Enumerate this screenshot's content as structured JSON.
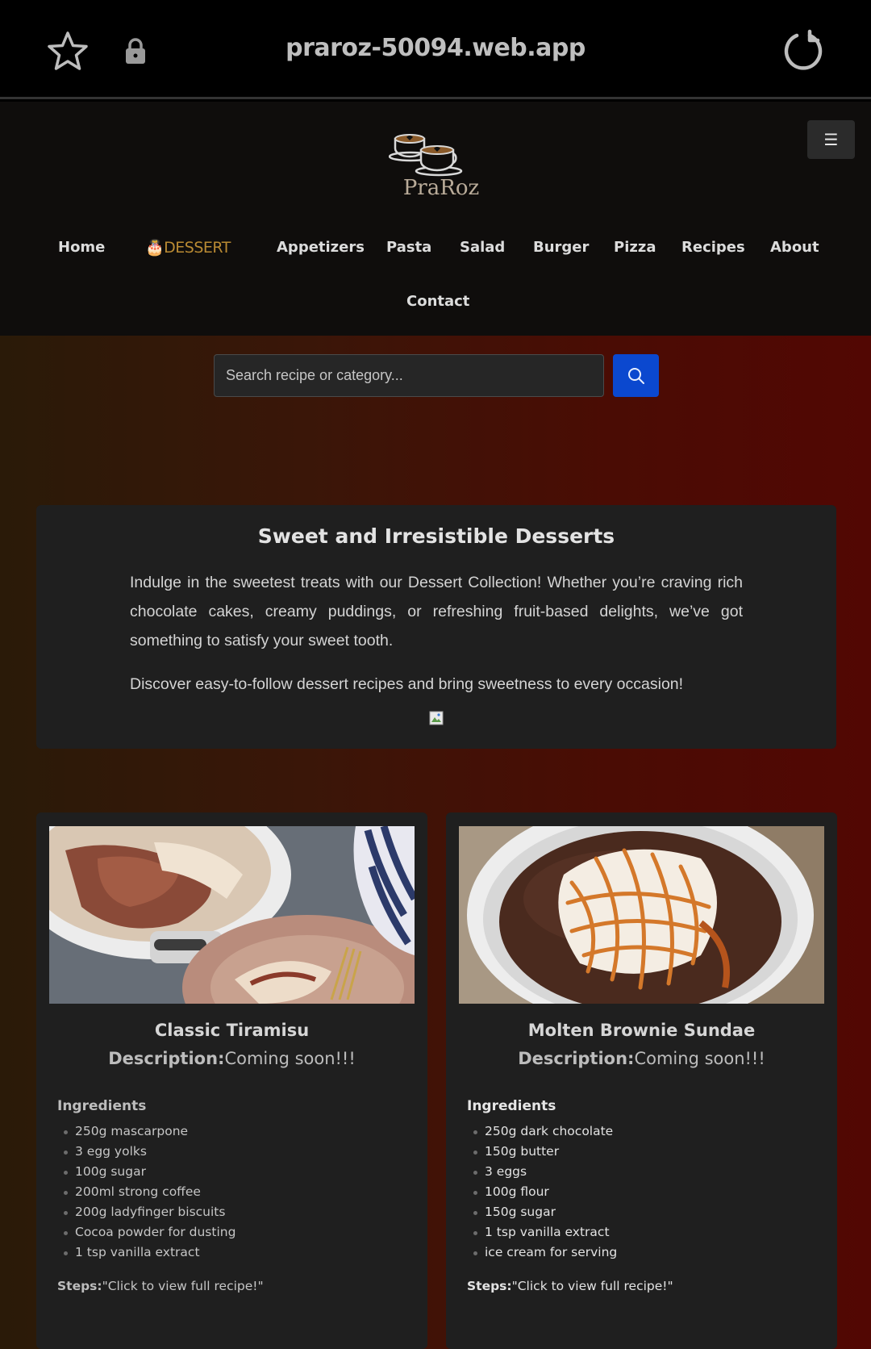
{
  "browser": {
    "url": "praroz-50094.web.app",
    "icons": [
      "star-icon",
      "lock-icon",
      "reload-icon"
    ]
  },
  "header": {
    "logo_text": "PraRoz",
    "menu_icon": "☰",
    "nav": [
      {
        "label": "Home"
      },
      {
        "label": "🎂DESSERT",
        "active": true
      },
      {
        "label": "Appetizers"
      },
      {
        "label": "Pasta"
      },
      {
        "label": "Salad"
      },
      {
        "label": "Burger"
      },
      {
        "label": "Pizza"
      },
      {
        "label": "Recipes"
      },
      {
        "label": "About"
      },
      {
        "label": "Contact"
      }
    ]
  },
  "search": {
    "placeholder": "Search recipe or category...",
    "button_color": "#0b48cf"
  },
  "intro": {
    "title": "Sweet and Irresistible Desserts",
    "paragraph1": "Indulge in the sweetest treats with our Dessert Collection! Whether you’re craving rich chocolate cakes, creamy puddings, or refreshing fruit-based delights, we’ve got something to satisfy your sweet tooth.",
    "paragraph2": "Discover easy-to-follow dessert recipes and bring sweetness to every occasion!"
  },
  "recipes": [
    {
      "title": "Classic Tiramisu",
      "description_label": "Description:",
      "description": "Coming soon!!!",
      "ingredients_heading": "Ingredients",
      "ingredients": [
        "250g mascarpone",
        "3 egg yolks",
        "100g sugar",
        "200ml strong coffee",
        "200g ladyfinger biscuits",
        "Cocoa powder for dusting",
        "1 tsp vanilla extract"
      ],
      "steps_label": "Steps:",
      "steps": "\"Click to view full recipe!\""
    },
    {
      "title": "Molten Brownie Sundae",
      "description_label": "Description:",
      "description": "Coming soon!!!",
      "ingredients_heading": "Ingredients",
      "ingredients": [
        "250g dark chocolate",
        "150g butter",
        "3 eggs",
        "100g flour",
        "150g sugar",
        "1 tsp vanilla extract",
        "ice cream for serving"
      ],
      "steps_label": "Steps:",
      "steps": "\"Click to view full recipe!\""
    }
  ],
  "colors": {
    "accent_active_nav": "#b98a33",
    "card_bg": "#1f1f1f",
    "gradient_left": "#2a1a08",
    "gradient_right": "#520703"
  }
}
